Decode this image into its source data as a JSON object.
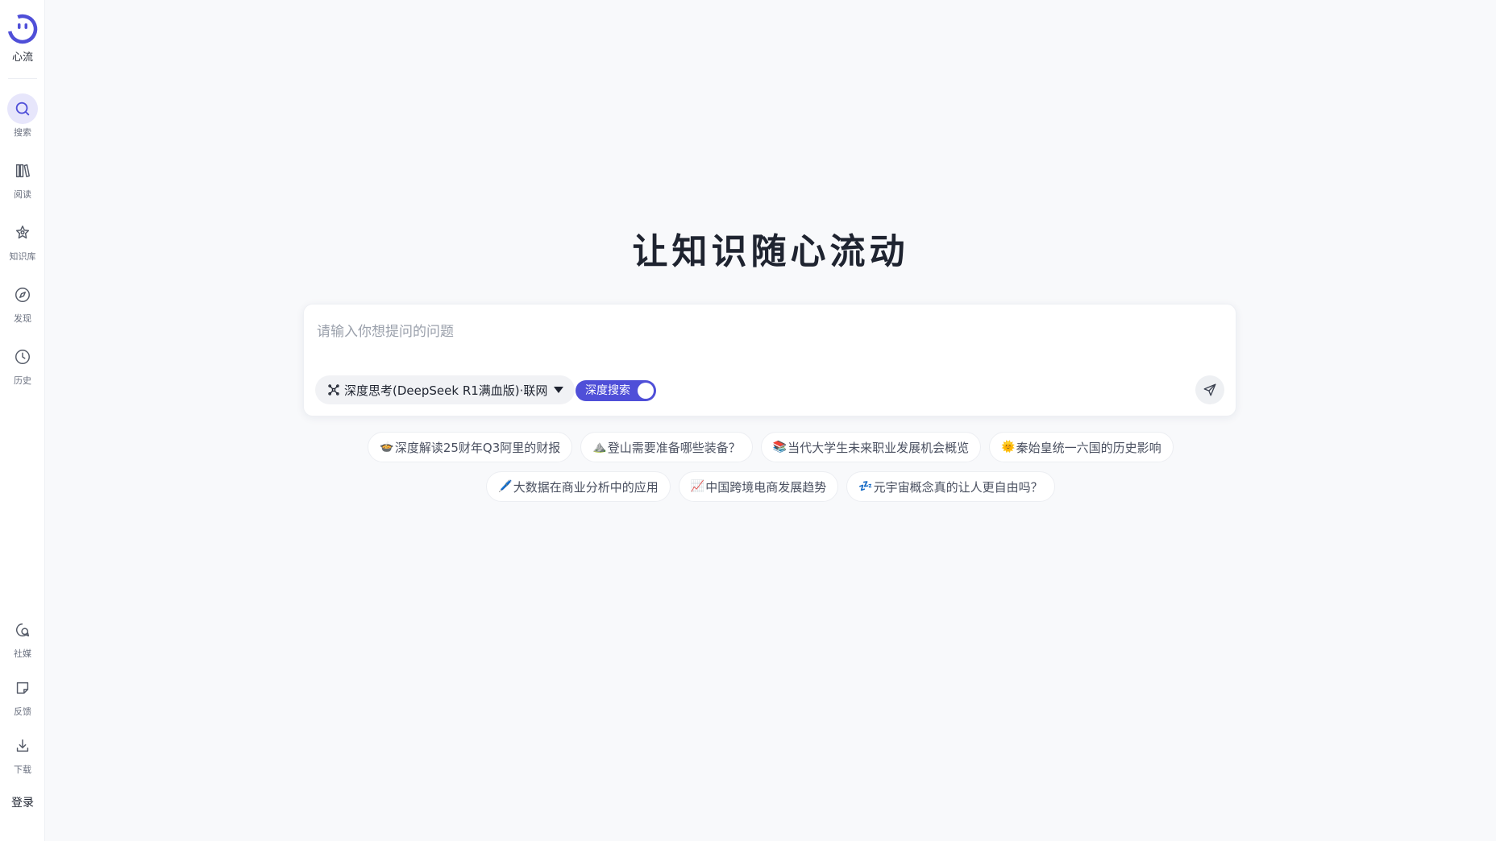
{
  "brand": {
    "name": "心流",
    "color": "#4f4fd8"
  },
  "sidebar": {
    "items": [
      {
        "label": "搜索",
        "icon": "search-icon",
        "active": true
      },
      {
        "label": "阅读",
        "icon": "book-icon",
        "active": false
      },
      {
        "label": "知识库",
        "icon": "knowledge-icon",
        "active": false
      },
      {
        "label": "发现",
        "icon": "compass-icon",
        "active": false
      },
      {
        "label": "历史",
        "icon": "clock-icon",
        "active": false
      }
    ],
    "bottom_items": [
      {
        "label": "社媒",
        "icon": "chat-icon"
      },
      {
        "label": "反馈",
        "icon": "feedback-icon"
      },
      {
        "label": "下载",
        "icon": "download-icon"
      }
    ],
    "login_label": "登录"
  },
  "main": {
    "headline": "让知识随心流动",
    "search": {
      "placeholder": "请输入你想提问的问题",
      "value": ""
    },
    "model_select": {
      "label": "深度思考(DeepSeek R1满血版)·联网"
    },
    "deep_search": {
      "label": "深度搜索",
      "enabled": true
    },
    "suggestions": [
      [
        {
          "emoji": "🍲",
          "text": "深度解读25财年Q3阿里的财报"
        },
        {
          "emoji": "⛰️",
          "text": "登山需要准备哪些装备？"
        },
        {
          "emoji": "📚",
          "text": "当代大学生未来职业发展机会概览"
        },
        {
          "emoji": "🌞",
          "text": "秦始皇统一六国的历史影响"
        }
      ],
      [
        {
          "emoji": "🖊️",
          "text": "大数据在商业分析中的应用"
        },
        {
          "emoji": "📈",
          "text": "中国跨境电商发展趋势"
        },
        {
          "emoji": "💤",
          "text": "元宇宙概念真的让人更自由吗？"
        }
      ]
    ]
  }
}
